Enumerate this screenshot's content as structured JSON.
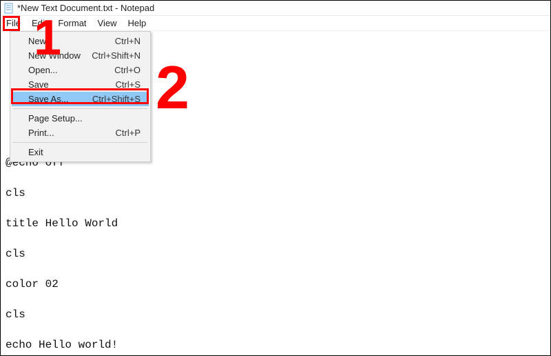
{
  "title": "*New Text Document.txt - Notepad",
  "menubar": {
    "file": "File",
    "edit": "Edit",
    "format": "Format",
    "view": "View",
    "help": "Help"
  },
  "dropdown": {
    "items": [
      {
        "label": "New",
        "shortcut": "Ctrl+N",
        "hovered": false
      },
      {
        "label": "New Window",
        "shortcut": "Ctrl+Shift+N",
        "hovered": false
      },
      {
        "label": "Open...",
        "shortcut": "Ctrl+O",
        "hovered": false
      },
      {
        "label": "Save",
        "shortcut": "Ctrl+S",
        "hovered": false
      },
      {
        "label": "Save As...",
        "shortcut": "Ctrl+Shift+S",
        "hovered": true
      },
      {
        "divider": true
      },
      {
        "label": "Page Setup...",
        "shortcut": "",
        "hovered": false
      },
      {
        "label": "Print...",
        "shortcut": "Ctrl+P",
        "hovered": false
      },
      {
        "divider": true
      },
      {
        "label": "Exit",
        "shortcut": "",
        "hovered": false
      }
    ]
  },
  "editor_content": "@echo off\n\ncls\n\ntitle Hello World\n\ncls\n\ncolor 02\n\ncls\n\necho Hello world!",
  "annotations": {
    "label1": "1",
    "label2": "2"
  }
}
